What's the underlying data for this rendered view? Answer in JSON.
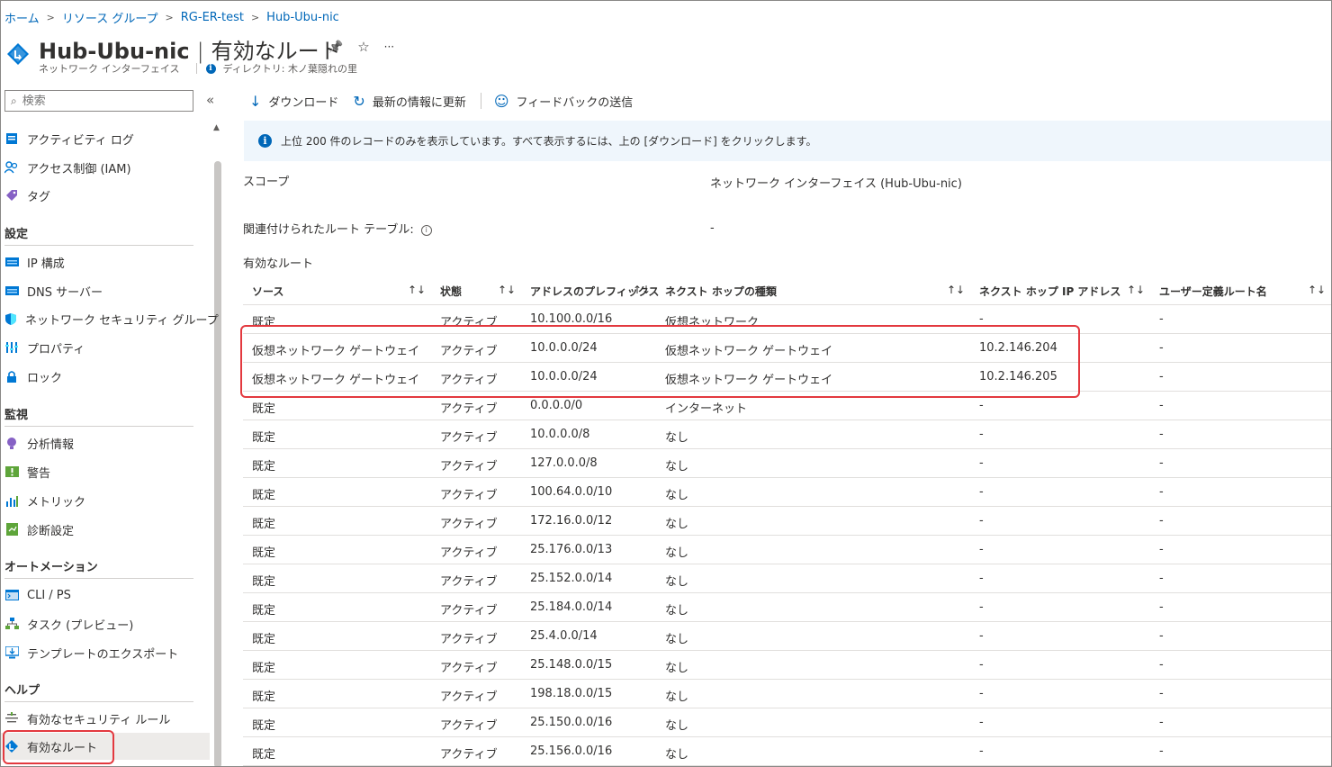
{
  "breadcrumb": [
    "ホーム",
    "リソース グループ",
    "RG-ER-test",
    "Hub-Ubu-nic"
  ],
  "header": {
    "resource_name": "Hub-Ubu-nic",
    "separator": "|",
    "page_name": "有効なルート",
    "resource_type": "ネットワーク インターフェイス",
    "directory": "ディレクトリ: 木ノ葉隠れの里",
    "pin": "📌",
    "star": "☆",
    "more": "···"
  },
  "sidebar": {
    "search_placeholder": "検索",
    "collapse": "«",
    "top_items": [
      {
        "label": "アクティビティ ログ",
        "icon": "activity-log-icon"
      },
      {
        "label": "アクセス制御 (IAM)",
        "icon": "iam-icon"
      },
      {
        "label": "タグ",
        "icon": "tag-icon"
      }
    ],
    "sections": [
      {
        "title": "設定",
        "items": [
          {
            "label": "IP 構成",
            "icon": "ip-config-icon"
          },
          {
            "label": "DNS サーバー",
            "icon": "dns-icon"
          },
          {
            "label": "ネットワーク セキュリティ グループ",
            "icon": "nsg-shield-icon"
          },
          {
            "label": "プロパティ",
            "icon": "properties-icon"
          },
          {
            "label": "ロック",
            "icon": "lock-icon"
          }
        ]
      },
      {
        "title": "監視",
        "items": [
          {
            "label": "分析情報",
            "icon": "insights-icon"
          },
          {
            "label": "警告",
            "icon": "alert-icon"
          },
          {
            "label": "メトリック",
            "icon": "metrics-icon"
          },
          {
            "label": "診断設定",
            "icon": "diagnostics-icon"
          }
        ]
      },
      {
        "title": "オートメーション",
        "items": [
          {
            "label": "CLI / PS",
            "icon": "cli-icon"
          },
          {
            "label": "タスク (プレビュー)",
            "icon": "tasks-icon"
          },
          {
            "label": "テンプレートのエクスポート",
            "icon": "export-template-icon"
          }
        ]
      },
      {
        "title": "ヘルプ",
        "items": [
          {
            "label": "有効なセキュリティ ルール",
            "icon": "security-rules-icon"
          },
          {
            "label": "有効なルート",
            "icon": "routes-icon",
            "active": true
          }
        ]
      }
    ]
  },
  "toolbar": {
    "download": "ダウンロード",
    "refresh": "最新の情報に更新",
    "feedback": "フィードバックの送信"
  },
  "banner": {
    "text": "上位 200 件のレコードのみを表示しています。すべて表示するには、上の [ダウンロード] をクリックします。"
  },
  "props": {
    "scope_label": "スコープ",
    "scope_value": "ネットワーク インターフェイス (Hub-Ubu-nic)",
    "route_table_label": "関連付けられたルート テーブル:",
    "route_table_value": "-",
    "routes_title": "有効なルート"
  },
  "table": {
    "headers": [
      "ソース",
      "状態",
      "アドレスのプレフィックス",
      "ネクスト ホップの種類",
      "ネクスト ホップ IP アドレス",
      "ユーザー定義ルート名"
    ],
    "sort_glyph": "↑↓",
    "rows": [
      [
        "既定",
        "アクティブ",
        "10.100.0.0/16",
        "仮想ネットワーク",
        "-",
        "-"
      ],
      [
        "仮想ネットワーク ゲートウェイ",
        "アクティブ",
        "10.0.0.0/24",
        "仮想ネットワーク ゲートウェイ",
        "10.2.146.204",
        "-"
      ],
      [
        "仮想ネットワーク ゲートウェイ",
        "アクティブ",
        "10.0.0.0/24",
        "仮想ネットワーク ゲートウェイ",
        "10.2.146.205",
        "-"
      ],
      [
        "既定",
        "アクティブ",
        "0.0.0.0/0",
        "インターネット",
        "-",
        "-"
      ],
      [
        "既定",
        "アクティブ",
        "10.0.0.0/8",
        "なし",
        "-",
        "-"
      ],
      [
        "既定",
        "アクティブ",
        "127.0.0.0/8",
        "なし",
        "-",
        "-"
      ],
      [
        "既定",
        "アクティブ",
        "100.64.0.0/10",
        "なし",
        "-",
        "-"
      ],
      [
        "既定",
        "アクティブ",
        "172.16.0.0/12",
        "なし",
        "-",
        "-"
      ],
      [
        "既定",
        "アクティブ",
        "25.176.0.0/13",
        "なし",
        "-",
        "-"
      ],
      [
        "既定",
        "アクティブ",
        "25.152.0.0/14",
        "なし",
        "-",
        "-"
      ],
      [
        "既定",
        "アクティブ",
        "25.184.0.0/14",
        "なし",
        "-",
        "-"
      ],
      [
        "既定",
        "アクティブ",
        "25.4.0.0/14",
        "なし",
        "-",
        "-"
      ],
      [
        "既定",
        "アクティブ",
        "25.148.0.0/15",
        "なし",
        "-",
        "-"
      ],
      [
        "既定",
        "アクティブ",
        "198.18.0.0/15",
        "なし",
        "-",
        "-"
      ],
      [
        "既定",
        "アクティブ",
        "25.150.0.0/16",
        "なし",
        "-",
        "-"
      ],
      [
        "既定",
        "アクティブ",
        "25.156.0.0/16",
        "なし",
        "-",
        "-"
      ]
    ]
  },
  "colors": {
    "accent": "#0067b8",
    "highlight": "#e3393f",
    "banner_bg": "#eff6fc"
  }
}
